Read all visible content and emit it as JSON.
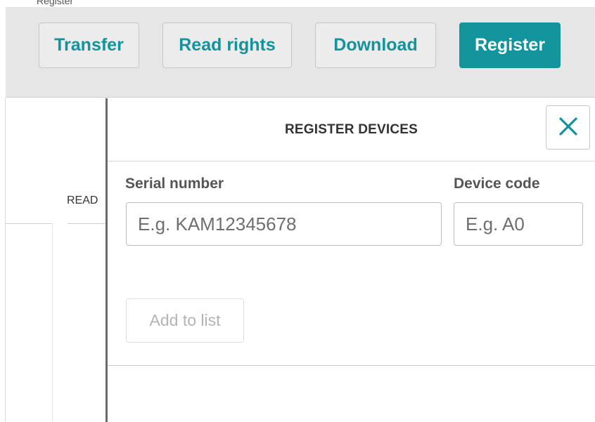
{
  "topstrip": {
    "text": "Register"
  },
  "toolbar": {
    "transfer_label": "Transfer",
    "read_rights_label": "Read rights",
    "download_label": "Download",
    "register_label": "Register",
    "accent_color": "#13939b"
  },
  "background": {
    "column_header": "READ"
  },
  "panel": {
    "title": "REGISTER DEVICES",
    "close_icon": "close-icon",
    "serial_label": "Serial number",
    "serial_placeholder": "E.g. KAM12345678",
    "serial_value": "",
    "device_code_label": "Device code",
    "device_code_placeholder": "E.g. A0",
    "device_code_value": "",
    "add_to_list_label": "Add to list"
  }
}
